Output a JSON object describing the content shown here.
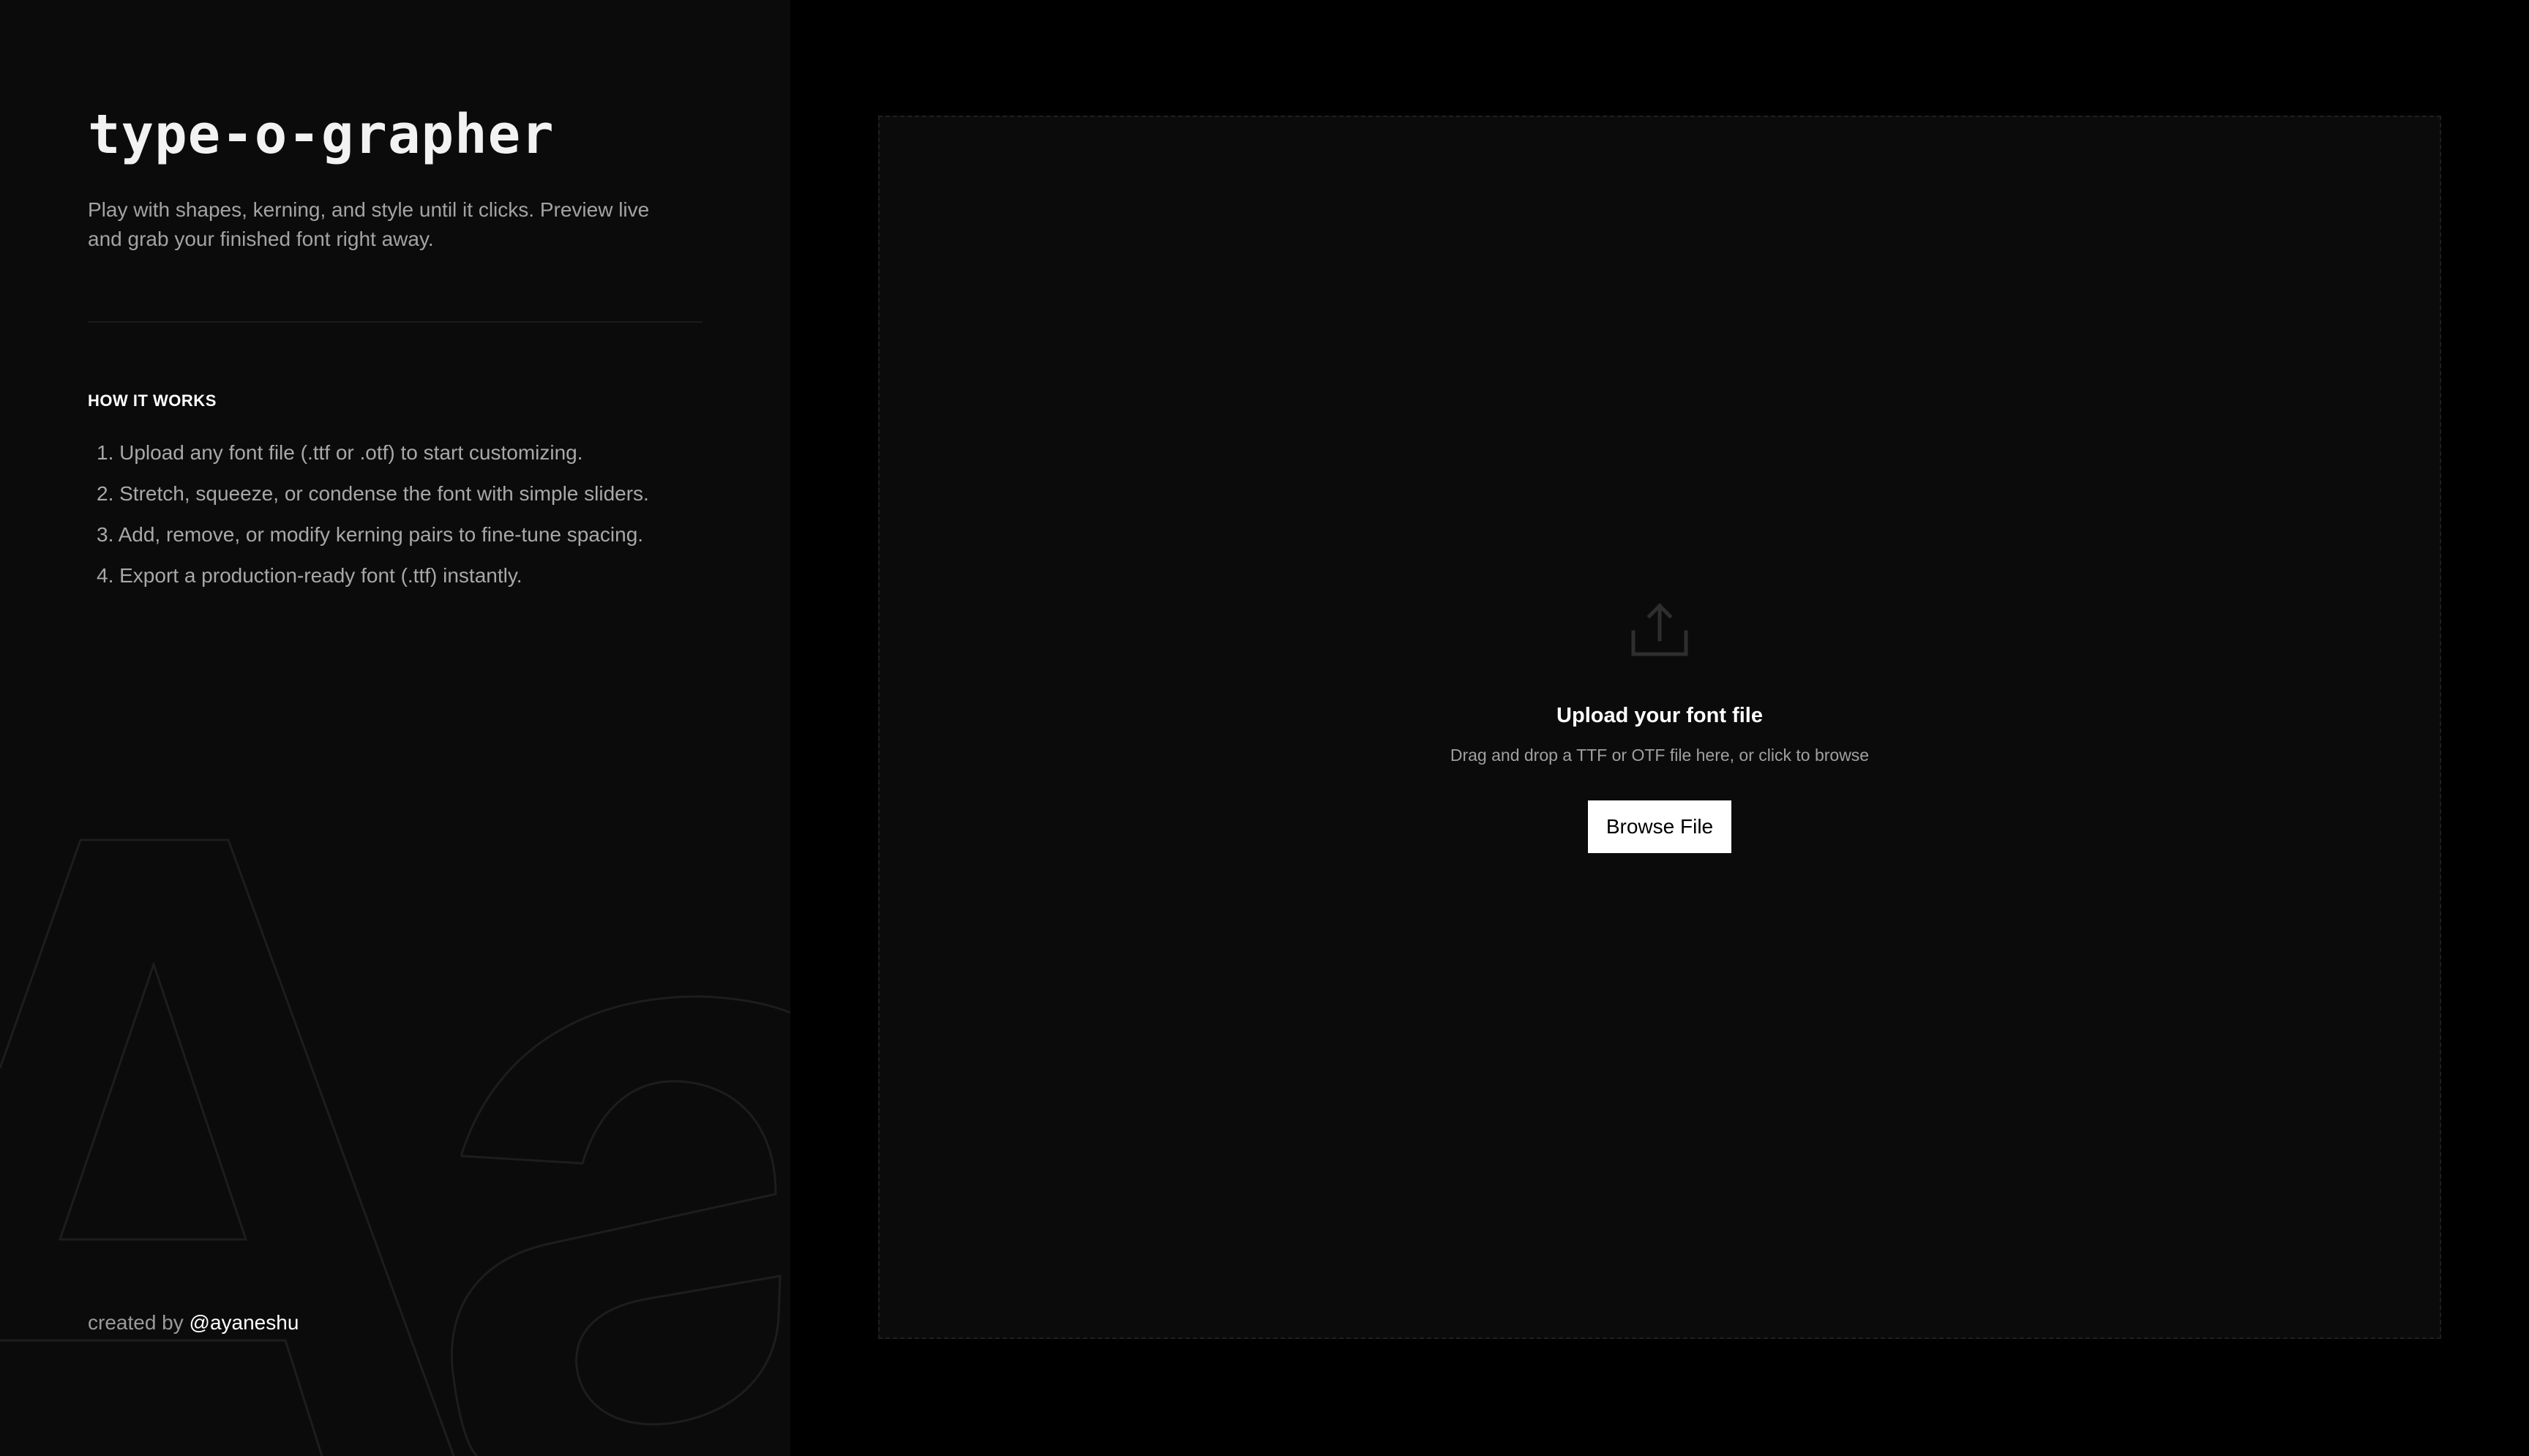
{
  "sidebar": {
    "title": "type-o-grapher",
    "tagline": "Play with shapes, kerning, and style until it clicks. Preview live and grab your finished font right away.",
    "how_it_works": {
      "heading": "HOW IT WORKS",
      "steps": [
        "1. Upload any font file (.ttf or .otf) to start customizing.",
        "2. Stretch, squeeze, or condense the font with simple sliders.",
        "3. Add, remove, or modify kerning pairs to fine-tune spacing.",
        "4. Export a production-ready font (.ttf) instantly."
      ]
    },
    "credit": {
      "prefix": "created by ",
      "handle": "@ayaneshu"
    },
    "background_glyphs": "Aa"
  },
  "dropzone": {
    "icon": "upload-icon",
    "title": "Upload your font file",
    "subtitle": "Drag and drop a TTF or OTF file here, or click to browse",
    "button_label": "Browse File"
  },
  "colors": {
    "page_background": "#000000",
    "panel_background": "#0b0b0b",
    "primary_text": "#ffffff",
    "secondary_text": "#a3a3a3",
    "button_background": "#ffffff"
  }
}
